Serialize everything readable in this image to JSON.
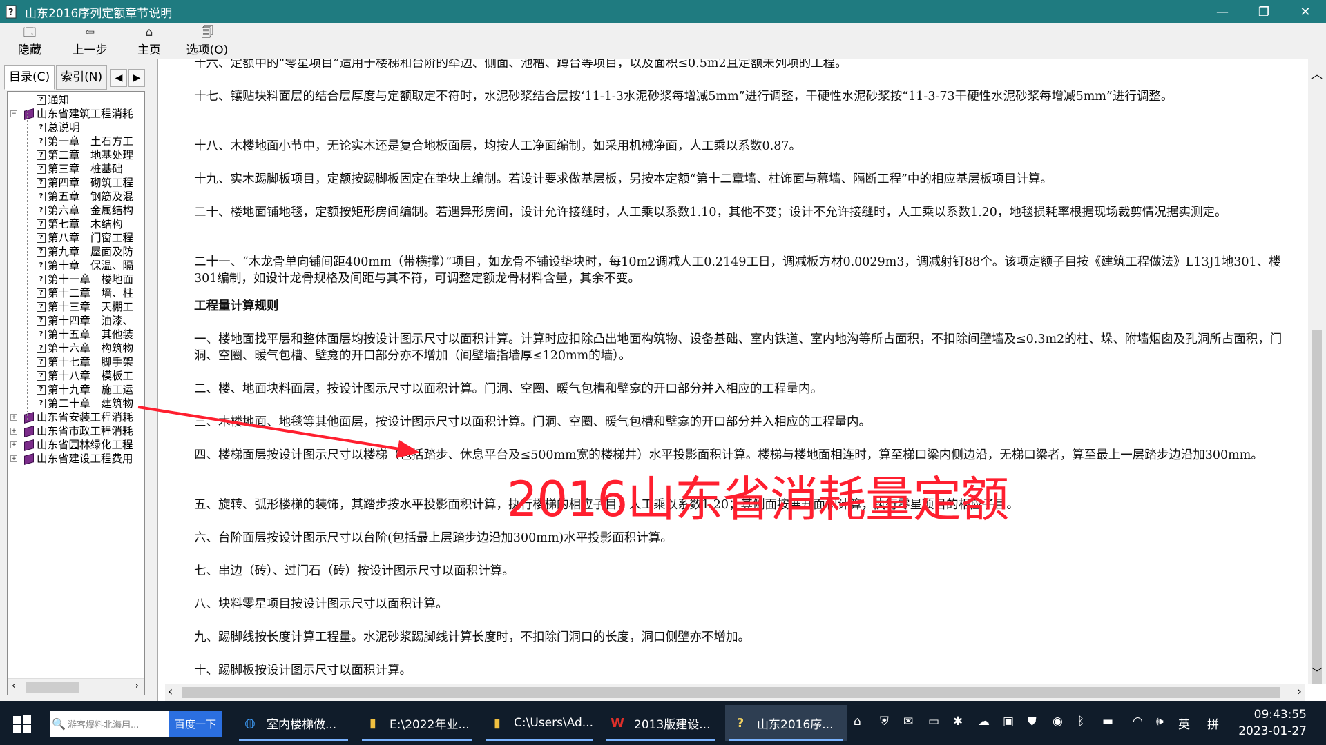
{
  "window": {
    "title": "山东2016序列定额章节说明",
    "minimize": "—",
    "restore": "❐",
    "close": "✕"
  },
  "toolbar": [
    {
      "label": "隐藏",
      "icon": "hide-icon"
    },
    {
      "label": "上一步",
      "icon": "back-arrow-icon"
    },
    {
      "label": "主页",
      "icon": "home-icon"
    },
    {
      "label": "选项(O)",
      "icon": "options-icon"
    }
  ],
  "tabs": {
    "contents": "目录(C)",
    "index": "索引(N)"
  },
  "tree": [
    {
      "label": "通知",
      "type": "page",
      "level": 1
    },
    {
      "label": "山东省建筑工程消耗",
      "type": "book-open",
      "level": 0,
      "expander": "−"
    },
    {
      "label": "总说明",
      "type": "page",
      "level": 2
    },
    {
      "label": "第一章　土石方工",
      "type": "page",
      "level": 2
    },
    {
      "label": "第二章　地基处理",
      "type": "page",
      "level": 2
    },
    {
      "label": "第三章　桩基础",
      "type": "page",
      "level": 2
    },
    {
      "label": "第四章　砌筑工程",
      "type": "page",
      "level": 2
    },
    {
      "label": "第五章　钢筋及混",
      "type": "page",
      "level": 2
    },
    {
      "label": "第六章　金属结构",
      "type": "page",
      "level": 2
    },
    {
      "label": "第七章　木结构",
      "type": "page",
      "level": 2
    },
    {
      "label": "第八章　门窗工程",
      "type": "page",
      "level": 2
    },
    {
      "label": "第九章　屋面及防",
      "type": "page",
      "level": 2
    },
    {
      "label": "第十章　保温、隔",
      "type": "page",
      "level": 2
    },
    {
      "label": "第十一章　楼地面",
      "type": "page",
      "level": 2
    },
    {
      "label": "第十二章　墙、柱",
      "type": "page",
      "level": 2
    },
    {
      "label": "第十三章　天棚工",
      "type": "page",
      "level": 2
    },
    {
      "label": "第十四章　油漆、",
      "type": "page",
      "level": 2
    },
    {
      "label": "第十五章　其他装",
      "type": "page",
      "level": 2
    },
    {
      "label": "第十六章　构筑物",
      "type": "page",
      "level": 2
    },
    {
      "label": "第十七章　脚手架",
      "type": "page",
      "level": 2
    },
    {
      "label": "第十八章　模板工",
      "type": "page",
      "level": 2
    },
    {
      "label": "第十九章　施工运",
      "type": "page",
      "level": 2
    },
    {
      "label": "第二十章　建筑物",
      "type": "page",
      "level": 2
    },
    {
      "label": "山东省安装工程消耗",
      "type": "book",
      "level": 0,
      "expander": "+"
    },
    {
      "label": "山东省市政工程消耗",
      "type": "book",
      "level": 0,
      "expander": "+"
    },
    {
      "label": "山东省园林绿化工程",
      "type": "book",
      "level": 0,
      "expander": "+"
    },
    {
      "label": "山东省建设工程费用",
      "type": "book",
      "level": 0,
      "expander": "+"
    }
  ],
  "content": {
    "paragraphs": [
      {
        "text": "十六、定额中的“零星项目”适用于楼梯和台阶的牵边、侧面、池槽、蹲台等项目，以及面积≤0.5m2且定额未列项的工程。",
        "lines": 1
      },
      {
        "text": "十七、镶贴块料面层的结合层厚度与定额取定不符时，水泥砂浆结合层按‘11-1-3水泥砂浆每增减5mm”进行调整，干硬性水泥砂浆按“11-3-73干硬性水泥砂浆每增减5mm”进行调整。",
        "lines": 2
      },
      {
        "text": "十八、木楼地面小节中，无论实木还是复合地板面层，均按人工净面编制，如采用机械净面，人工乘以系数0.87。",
        "lines": 1
      },
      {
        "text": "十九、实木踢脚板项目，定额按踢脚板固定在垫块上编制。若设计要求做基层板，另按本定额“第十二章墙、柱饰面与幕墙、隔断工程”中的相应基层板项目计算。",
        "lines": 1
      },
      {
        "text": "二十、楼地面铺地毯，定额按矩形房间编制。若遇异形房间，设计允许接缝时，人工乘以系数1.10，其他不变；设计不允许接缝时，人工乘以系数1.20，地毯损耗率根据现场裁剪情况据实测定。",
        "lines": 2
      },
      {
        "text": "二十一、“木龙骨单向铺间距400mm（带横撑）”项目，如龙骨不铺设垫块时，每10m2调减人工0.2149工日，调减板方材0.0029m3，调减射钉88个。该项定额子目按《建筑工程做法》L13J1地301、楼301编制，如设计龙骨规格及间距与其不符，可调整定额龙骨材料含量，其余不变。",
        "lines": 2
      },
      {
        "text": "工程量计算规则",
        "lines": 1,
        "heading": true
      },
      {
        "text": "一、楼地面找平层和整体面层均按设计图示尺寸以面积计算。计算时应扣除凸出地面构筑物、设备基础、室内铁道、室内地沟等所占面积，不扣除间壁墙及≤0.3m2的柱、垛、附墙烟囱及孔洞所占面积，门洞、空圈、暖气包槽、壁龛的开口部分亦不增加（间壁墙指墙厚≤120mm的墙）。",
        "lines": 2
      },
      {
        "text": "二、楼、地面块料面层，按设计图示尺寸以面积计算。门洞、空圈、暖气包槽和壁龛的开口部分并入相应的工程量内。",
        "lines": 1
      },
      {
        "text": "三、木楼地面、地毯等其他面层，按设计图示尺寸以面积计算。门洞、空圈、暖气包槽和壁龛的开口部分并入相应的工程量内。",
        "lines": 1
      },
      {
        "text": "四、楼梯面层按设计图示尺寸以楼梯（包括踏步、休息平台及≤500mm宽的楼梯井）水平投影面积计算。楼梯与楼地面相连时，算至梯口梁内侧边沿，无梯口梁者，算至最上一层踏步边沿加300mm。",
        "lines": 2
      },
      {
        "text": "五、旋转、弧形楼梯的装饰，其踏步按水平投影面积计算，执行楼梯的相应子目，人工乘以系数1.20；其侧面按展开面积计算，执行零星项目的相应子目。",
        "lines": 1
      },
      {
        "text": "六、台阶面层按设计图示尺寸以台阶(包括最上层踏步边沿加300mm)水平投影面积计算。",
        "lines": 1
      },
      {
        "text": "七、串边（砖）、过门石（砖）按设计图示尺寸以面积计算。",
        "lines": 1
      },
      {
        "text": "八、块料零星项目按设计图示尺寸以面积计算。",
        "lines": 1
      },
      {
        "text": "九、踢脚线按长度计算工程量。水泥砂浆踢脚线计算长度时，不扣除门洞口的长度，洞口侧壁亦不增加。",
        "lines": 1
      },
      {
        "text": "十、踢脚板按设计图示尺寸以面积计算。",
        "lines": 1
      }
    ]
  },
  "overlay": {
    "caption": "2016山东省消耗量定额",
    "color": "#ff1f2f"
  },
  "taskbar": {
    "search_placeholder": "游客爆料北海用...",
    "search_button": "百度一下",
    "tasks": [
      {
        "label": "室内楼梯做...",
        "icon": "browser-icon"
      },
      {
        "label": "E:\\2022年业...",
        "icon": "folder-icon"
      },
      {
        "label": "C:\\Users\\Ad...",
        "icon": "folder-icon"
      },
      {
        "label": "2013版建设...",
        "icon": "wps-icon"
      },
      {
        "label": "山东2016序...",
        "icon": "help-file-icon",
        "active": true
      }
    ],
    "ime": "英",
    "ime_mode": "拼",
    "time": "09:43:55",
    "date": "2023-01-27"
  }
}
